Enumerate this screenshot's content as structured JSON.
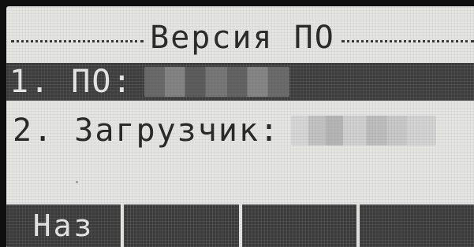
{
  "screen": {
    "title": "Версия ПО"
  },
  "menu": {
    "items": [
      {
        "label": "1. ПО:",
        "value_hidden": true,
        "selected": true
      },
      {
        "label": "2. Загрузчик:",
        "value_hidden": true,
        "selected": false
      }
    ]
  },
  "softkeys": [
    {
      "label": "Наз"
    },
    {
      "label": ""
    },
    {
      "label": ""
    },
    {
      "label": ""
    }
  ],
  "colors": {
    "lcd_background": "#e4e4e2",
    "highlight": "#3d3d3d",
    "text_dark": "#2a2a2a",
    "text_light": "#e6e6e6"
  }
}
